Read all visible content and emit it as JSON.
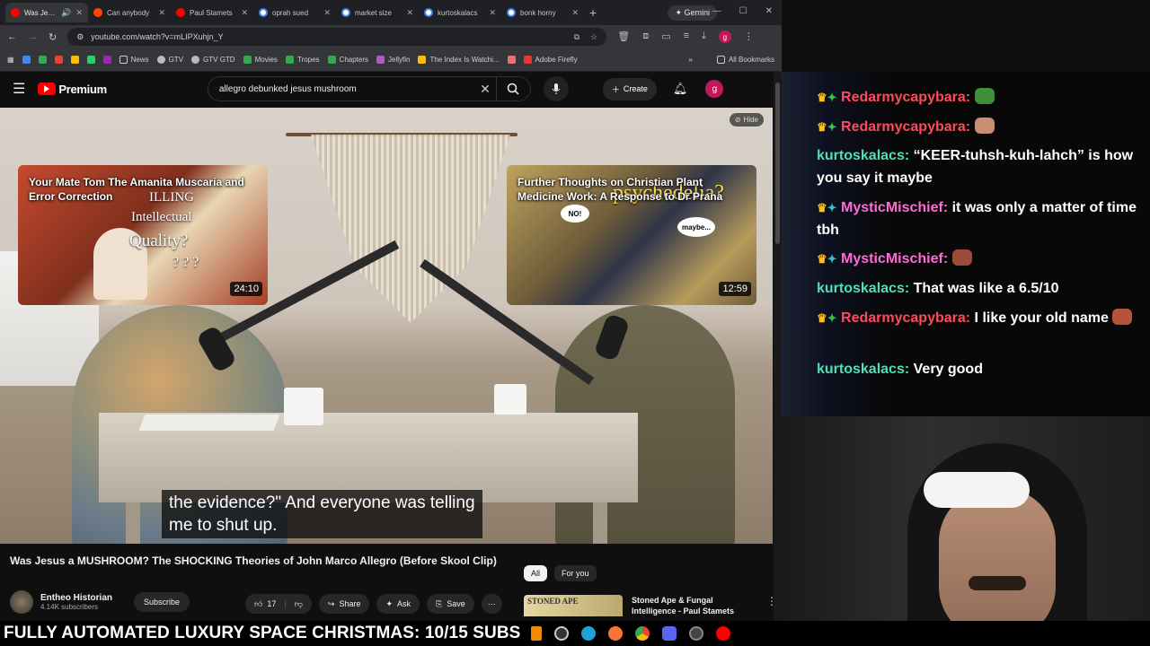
{
  "browser": {
    "tabs": [
      {
        "label": "Was Jesus",
        "icon": "youtube-icon",
        "color": "#ff0000",
        "active": true
      },
      {
        "label": "Can anybody",
        "icon": "reddit-icon",
        "color": "#ff4500",
        "active": false
      },
      {
        "label": "Paul Stamets",
        "icon": "youtube-icon",
        "color": "#ff0000",
        "active": false
      },
      {
        "label": "oprah sued",
        "icon": "google-icon",
        "color": "#4285f4",
        "active": false
      },
      {
        "label": "market size",
        "icon": "google-icon",
        "color": "#4285f4",
        "active": false
      },
      {
        "label": "kurtoskalacs",
        "icon": "google-icon",
        "color": "#4285f4",
        "active": false
      },
      {
        "label": "bonk horny",
        "icon": "google-icon",
        "color": "#4285f4",
        "active": false
      }
    ],
    "new_tab": "+",
    "gemini_label": "Gemini",
    "url": "youtube.com/watch?v=mLIPXuhjn_Y",
    "bookmarks": [
      {
        "label": "News",
        "color": "#5f6368"
      },
      {
        "label": "GTV",
        "color": "#5f6368"
      },
      {
        "label": "GTV GTD",
        "color": "#5f6368"
      },
      {
        "label": "Movies",
        "color": "#34a853"
      },
      {
        "label": "Tropes",
        "color": "#34a853"
      },
      {
        "label": "Chapters",
        "color": "#34a853"
      },
      {
        "label": "Jellyfin",
        "color": "#aa5cc3"
      },
      {
        "label": "The Index Is Watchi...",
        "color": "#fbbc04"
      },
      {
        "label": "Adobe Firefly",
        "color": "#e53935"
      }
    ],
    "all_bookmarks": "All Bookmarks",
    "profile_initial": "g"
  },
  "youtube": {
    "brand": "Premium",
    "search_value": "allegro debunked jesus mushroom",
    "create_label": "Create",
    "avatar_initial": "g",
    "hide_label": "Hide",
    "endcards": [
      {
        "title": "Your Mate Tom The Amanita Muscaria and Error Correction",
        "duration": "24:10",
        "overlay": [
          "ILLING",
          "Intellectual",
          "Quality?",
          "? ? ?"
        ]
      },
      {
        "title": "Further Thoughts on Christian Plant Medicine Work: A Response to Dr Prana",
        "duration": "12:59",
        "overlay": [
          "psychedelia?",
          "NO!",
          "maybe..."
        ]
      }
    ],
    "caption_line1": "the evidence?\" And everyone was telling",
    "caption_line2": "me to shut up.",
    "video_title": "Was Jesus a MUSHROOM? The SHOCKING Theories of John Marco Allegro (Before Skool Clip)",
    "channel_name": "Entheo Historian",
    "channel_subs": "4.14K subscribers",
    "subscribe_label": "Subscribe",
    "likes": "17",
    "share_label": "Share",
    "ask_label": "Ask",
    "save_label": "Save",
    "filter_all": "All",
    "filter_foryou": "For you",
    "rec_thumb_text": "STONED APE",
    "rec_title": "Stoned Ape & Fungal Intelligence - Paul Stamets"
  },
  "chat": {
    "messages": [
      {
        "user": "Redarmycapybara:",
        "color": "#ff4a5c",
        "badges": [
          "crown",
          "gem"
        ],
        "text": "",
        "emote": "#3e8e3a"
      },
      {
        "user": "Redarmycapybara:",
        "color": "#ff4a5c",
        "badges": [
          "crown",
          "gem"
        ],
        "text": "",
        "emote": "#c98d73"
      },
      {
        "user": "kurtoskalacs:",
        "color": "#4ee0b4",
        "badges": [],
        "text": "“KEER-tuhsh-kuh-lahch” is how you say it maybe"
      },
      {
        "user": "MysticMischief:",
        "color": "#ff6bd6",
        "badges": [
          "crown",
          "gem"
        ],
        "text": "it was only a matter of time tbh"
      },
      {
        "user": "MysticMischief:",
        "color": "#ff6bd6",
        "badges": [
          "crown",
          "gem"
        ],
        "text": "",
        "emote": "#9b4b3a"
      },
      {
        "user": "kurtoskalacs:",
        "color": "#4ee0b4",
        "badges": [],
        "text": "That was like a 6.5/10"
      },
      {
        "user": "Redarmycapybara:",
        "color": "#ff4a5c",
        "badges": [
          "crown",
          "gem"
        ],
        "text": "I like your old name",
        "emote": "#b5533e"
      },
      {
        "user": "kurtoskalacs:",
        "color": "#4ee0b4",
        "badges": [],
        "text": "Very good"
      }
    ]
  },
  "ticker": {
    "text": "FULLY AUTOMATED LUXURY SPACE CHRISTMAS: 10/15 SUBS"
  }
}
